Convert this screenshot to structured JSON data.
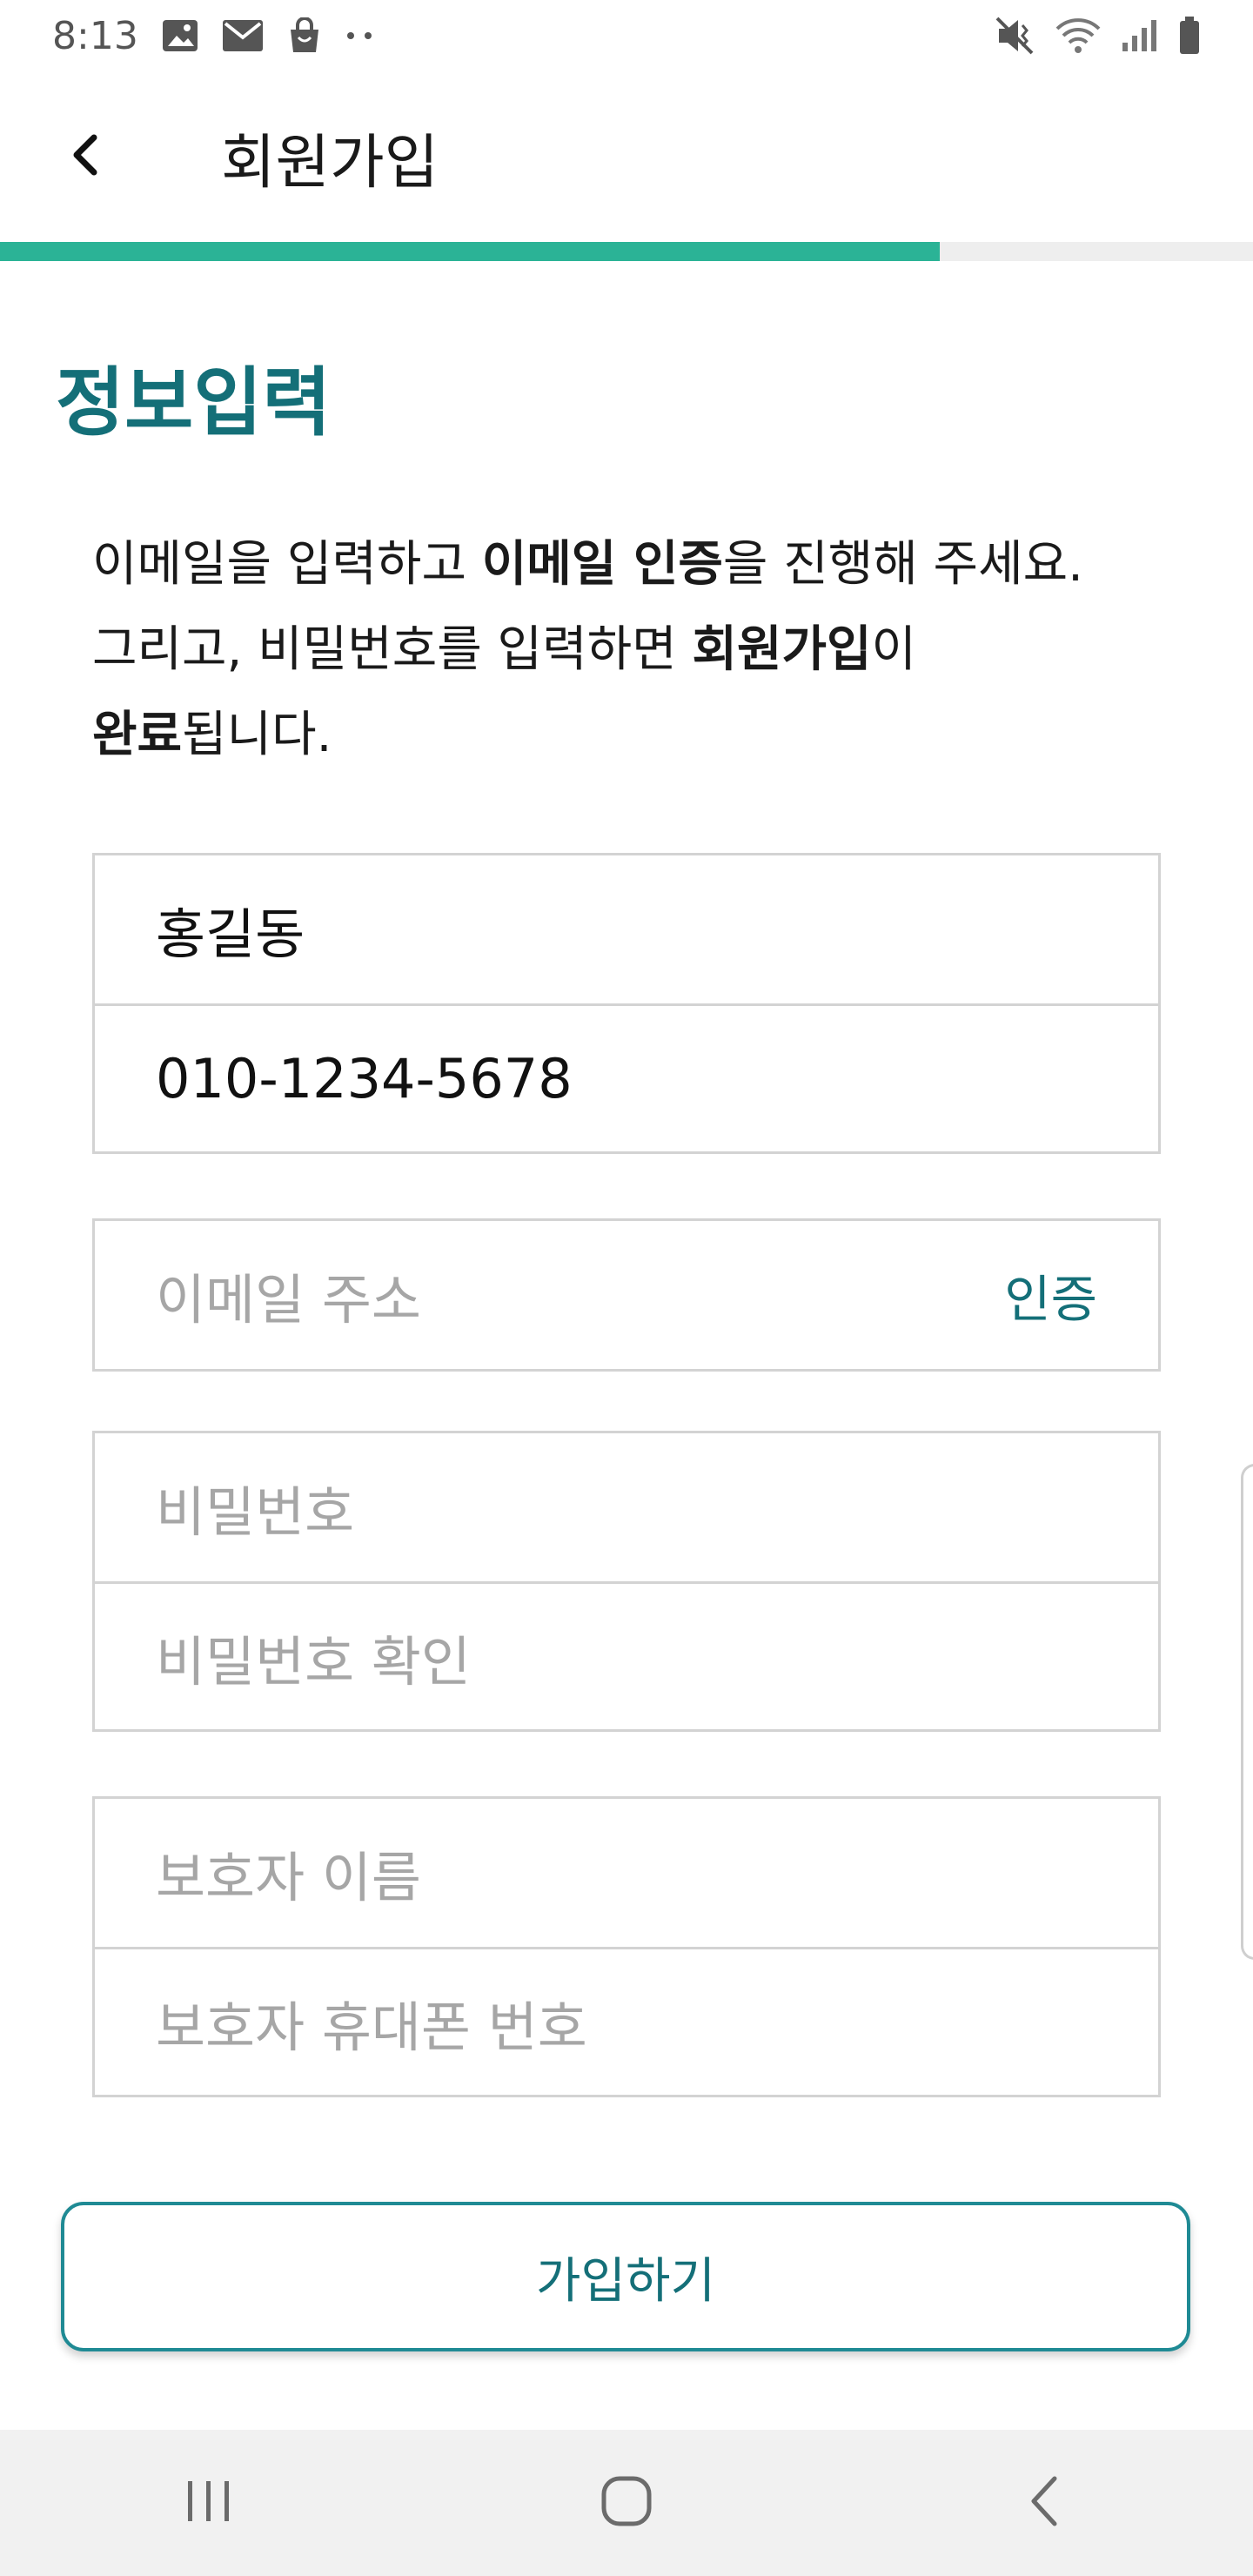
{
  "status_bar": {
    "time": "8:13",
    "left_icons": [
      "image-icon",
      "mail-icon",
      "shopping-bag-icon",
      "more-dots-icon"
    ],
    "right_icons": [
      "mute-icon",
      "wifi-icon",
      "signal-icon",
      "battery-icon"
    ]
  },
  "app_bar": {
    "title": "회원가입",
    "back_icon": "chevron-left-icon"
  },
  "progress": {
    "value": 0.75,
    "fill_color": "#2bb396",
    "track_color": "#eeeeee"
  },
  "section": {
    "title": "정보입력",
    "title_color": "#146f78"
  },
  "intro": {
    "part1": "이메일을 입력하고 ",
    "bold1": "이메일 인증",
    "part2": "을 진행해 주세요.",
    "part3": "그리고, 비밀번호를 입력하면 ",
    "bold2": "회원가입",
    "part4": "이",
    "bold3": "완료",
    "part5": "됩니다."
  },
  "fields": {
    "name_value": "홍길동",
    "phone_value": "010-1234-5678",
    "email_placeholder": "이메일 주소",
    "verify_label": "인증",
    "password_placeholder": "비밀번호",
    "password_confirm_placeholder": "비밀번호 확인",
    "guardian_name_placeholder": "보호자 이름",
    "guardian_phone_placeholder": "보호자 휴대폰 번호"
  },
  "signup_button": {
    "label": "가입하기",
    "color": "#146f78"
  },
  "nav_bar": {
    "items": [
      "recent-apps-icon",
      "home-icon",
      "back-icon"
    ]
  }
}
